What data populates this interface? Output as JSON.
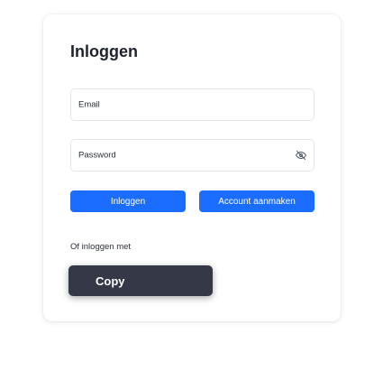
{
  "login": {
    "title": "Inloggen",
    "email_placeholder": "Email",
    "password_placeholder": "Password",
    "login_button": "Inloggen",
    "register_button": "Account aanmaken",
    "alt_login_text": "Of inloggen met"
  },
  "popup": {
    "label": "Copy"
  },
  "icons": {
    "password_toggle": "eye-off-icon"
  },
  "colors": {
    "primary": "#1a6dff",
    "tooltip_bg": "#353847"
  }
}
